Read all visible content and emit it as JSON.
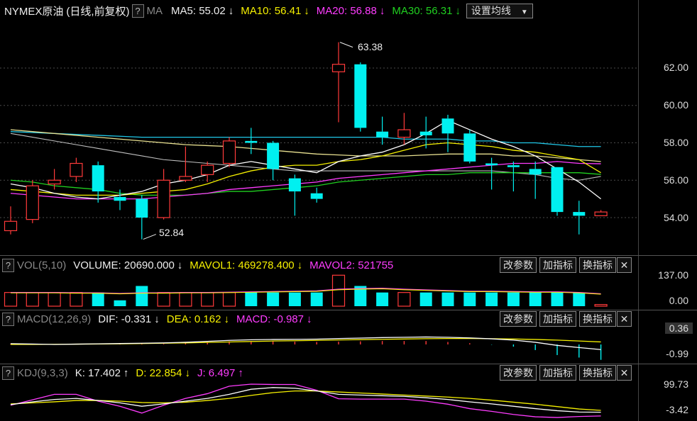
{
  "header": {
    "title": "NYMEX原油",
    "subtitle": "(日线,前复权)",
    "help": "?",
    "ma_label": "MA",
    "ma5": {
      "label": "MA5: 55.02",
      "arrow": "↓",
      "color": "#ffffff"
    },
    "ma10": {
      "label": "MA10: 56.41",
      "arrow": "↓",
      "color": "#f5f000"
    },
    "ma20": {
      "label": "MA20: 56.88",
      "arrow": "↓",
      "color": "#ff3cff"
    },
    "ma30": {
      "label": "MA30: 56.31",
      "arrow": "↓",
      "color": "#20d020"
    },
    "settings": "设置均线"
  },
  "price_axis": [
    "62.00",
    "60.00",
    "58.00",
    "56.00",
    "54.00"
  ],
  "annotations": {
    "high": "63.38",
    "low": "52.84"
  },
  "vol_panel": {
    "help": "?",
    "name": "VOL(5,10)",
    "volume": "VOLUME: 20690.000",
    "volume_arrow": "↓",
    "mavol1": "MAVOL1: 469278.400",
    "mavol1_arrow": "↓",
    "mavol2": "MAVOL2: 521755",
    "axis": [
      "137.00",
      "0.00"
    ]
  },
  "macd_panel": {
    "help": "?",
    "name": "MACD(12,26,9)",
    "dif": "DIF: -0.331",
    "dif_arrow": "↓",
    "dea": "DEA: 0.162",
    "dea_arrow": "↓",
    "macd": "MACD: -0.987",
    "macd_arrow": "↓",
    "axis": [
      "0.36",
      "-0.99"
    ]
  },
  "kdj_panel": {
    "help": "?",
    "name": "KDJ(9,3,3)",
    "k": "K: 17.402",
    "k_arrow": "↑",
    "d": "D: 22.854",
    "d_arrow": "↓",
    "j": "J: 6.497",
    "j_arrow": "↑",
    "axis": [
      "99.73",
      "-3.42"
    ]
  },
  "buttons": {
    "params": "改参数",
    "add": "加指标",
    "swap": "换指标",
    "close": "✕"
  },
  "colors": {
    "up": "#ff3a3a",
    "down": "#00f0f0",
    "ma5": "#ffffff",
    "ma10": "#f5f000",
    "ma20": "#ff3cff",
    "ma30": "#20d020"
  },
  "chart_data": {
    "type": "candlestick",
    "yaxis_ticks": [
      54,
      56,
      58,
      60,
      62
    ],
    "candles": [
      {
        "o": 53.3,
        "c": 53.8,
        "h": 54.6,
        "l": 53.1,
        "up": true
      },
      {
        "o": 53.9,
        "c": 55.7,
        "h": 56.0,
        "l": 53.7,
        "up": true
      },
      {
        "o": 55.8,
        "c": 56.0,
        "h": 56.6,
        "l": 55.5,
        "up": true
      },
      {
        "o": 56.2,
        "c": 56.9,
        "h": 57.2,
        "l": 55.9,
        "up": true
      },
      {
        "o": 56.8,
        "c": 55.4,
        "h": 57.0,
        "l": 54.8,
        "up": false
      },
      {
        "o": 55.1,
        "c": 54.9,
        "h": 55.5,
        "l": 54.4,
        "up": false
      },
      {
        "o": 55.0,
        "c": 54.0,
        "h": 55.2,
        "l": 52.84,
        "up": false
      },
      {
        "o": 54.0,
        "c": 56.0,
        "h": 56.6,
        "l": 53.9,
        "up": true
      },
      {
        "o": 56.0,
        "c": 56.2,
        "h": 57.8,
        "l": 55.9,
        "up": true
      },
      {
        "o": 56.3,
        "c": 56.8,
        "h": 57.0,
        "l": 55.9,
        "up": true
      },
      {
        "o": 56.9,
        "c": 58.1,
        "h": 58.3,
        "l": 56.7,
        "up": true
      },
      {
        "o": 58.1,
        "c": 58.0,
        "h": 58.8,
        "l": 57.4,
        "up": false
      },
      {
        "o": 58.0,
        "c": 56.6,
        "h": 58.1,
        "l": 56.0,
        "up": false
      },
      {
        "o": 56.1,
        "c": 55.4,
        "h": 56.3,
        "l": 54.1,
        "up": false
      },
      {
        "o": 55.3,
        "c": 55.0,
        "h": 55.6,
        "l": 54.8,
        "up": false
      },
      {
        "o": 61.8,
        "c": 62.2,
        "h": 63.38,
        "l": 59.1,
        "up": true
      },
      {
        "o": 62.2,
        "c": 58.8,
        "h": 62.3,
        "l": 58.6,
        "up": false
      },
      {
        "o": 58.6,
        "c": 58.3,
        "h": 59.4,
        "l": 57.9,
        "up": false
      },
      {
        "o": 58.3,
        "c": 58.7,
        "h": 59.6,
        "l": 57.9,
        "up": true
      },
      {
        "o": 58.6,
        "c": 58.4,
        "h": 59.4,
        "l": 57.7,
        "up": false
      },
      {
        "o": 59.3,
        "c": 58.5,
        "h": 59.5,
        "l": 57.5,
        "up": false
      },
      {
        "o": 58.5,
        "c": 57.0,
        "h": 58.7,
        "l": 56.9,
        "up": false
      },
      {
        "o": 56.9,
        "c": 56.8,
        "h": 57.2,
        "l": 55.5,
        "up": false
      },
      {
        "o": 56.8,
        "c": 56.7,
        "h": 57.0,
        "l": 55.4,
        "up": false
      },
      {
        "o": 56.6,
        "c": 56.3,
        "h": 57.0,
        "l": 55.0,
        "up": false
      },
      {
        "o": 56.7,
        "c": 54.3,
        "h": 56.7,
        "l": 54.1,
        "up": false
      },
      {
        "o": 54.3,
        "c": 54.1,
        "h": 54.9,
        "l": 53.1,
        "up": false
      },
      {
        "o": 54.1,
        "c": 54.3,
        "h": 54.4,
        "l": 54.1,
        "up": true
      }
    ],
    "ma5": [
      55.8,
      55.6,
      55.3,
      55.1,
      55.0,
      55.2,
      55.4,
      55.8,
      56.0,
      56.3,
      56.8,
      57.0,
      56.8,
      56.6,
      56.4,
      57.0,
      57.3,
      57.5,
      57.9,
      58.5,
      59.2,
      58.7,
      58.2,
      57.8,
      57.3,
      56.6,
      55.9,
      55.0
    ],
    "ma10": [
      55.5,
      55.4,
      55.3,
      55.2,
      55.2,
      55.2,
      55.3,
      55.4,
      55.5,
      55.8,
      56.2,
      56.5,
      56.7,
      56.8,
      56.8,
      57.0,
      57.1,
      57.3,
      57.6,
      57.9,
      58.0,
      57.9,
      57.8,
      57.6,
      57.5,
      57.3,
      57.1,
      56.4
    ],
    "ma20": [
      55.3,
      55.2,
      55.1,
      55.0,
      55.0,
      55.0,
      55.0,
      55.1,
      55.2,
      55.3,
      55.5,
      55.6,
      55.7,
      55.8,
      55.9,
      56.1,
      56.2,
      56.3,
      56.4,
      56.5,
      56.6,
      56.7,
      56.8,
      56.9,
      56.9,
      57.0,
      56.9,
      56.88
    ],
    "ma30": [
      56.0,
      55.9,
      55.7,
      55.6,
      55.5,
      55.3,
      55.2,
      55.2,
      55.2,
      55.3,
      55.4,
      55.4,
      55.5,
      55.6,
      55.7,
      55.9,
      56.0,
      56.1,
      56.2,
      56.3,
      56.3,
      56.4,
      56.4,
      56.4,
      56.4,
      56.4,
      56.4,
      56.31
    ],
    "long_line1": [
      58.6,
      58.55,
      58.5,
      58.45,
      58.4,
      58.35,
      58.3,
      58.3,
      58.3,
      58.3,
      58.3,
      58.3,
      58.3,
      58.3,
      58.3,
      58.3,
      58.3,
      58.3,
      58.2,
      58.2,
      58.2,
      58.1,
      58.1,
      58.0,
      58.0,
      57.9,
      57.8,
      57.8
    ],
    "long_line2": [
      58.7,
      58.6,
      58.5,
      58.4,
      58.3,
      58.2,
      58.1,
      58.0,
      57.9,
      57.85,
      57.8,
      57.7,
      57.6,
      57.5,
      57.4,
      57.35,
      57.3,
      57.3,
      57.3,
      57.35,
      57.4,
      57.4,
      57.4,
      57.3,
      57.3,
      57.2,
      57.1,
      57.0
    ],
    "long_line3": [
      58.5,
      58.3,
      58.1,
      57.9,
      57.7,
      57.5,
      57.3,
      57.1,
      57.0,
      56.9,
      56.8,
      56.7,
      56.6,
      56.5,
      56.5,
      56.5,
      56.5,
      56.5,
      56.5,
      56.5,
      56.5,
      56.5,
      56.5,
      56.4,
      56.3,
      56.1,
      56.0,
      56.2
    ],
    "volume": [
      0.42,
      0.42,
      0.42,
      0.42,
      0.42,
      0.18,
      0.62,
      0.42,
      0.42,
      0.42,
      0.42,
      0.42,
      0.42,
      0.42,
      0.42,
      0.95,
      0.62,
      0.42,
      0.42,
      0.42,
      0.42,
      0.42,
      0.42,
      0.42,
      0.42,
      0.42,
      0.42,
      0.05
    ],
    "mavol": [
      0.42,
      0.42,
      0.42,
      0.41,
      0.41,
      0.39,
      0.41,
      0.41,
      0.42,
      0.42,
      0.43,
      0.44,
      0.45,
      0.46,
      0.47,
      0.52,
      0.54,
      0.55,
      0.52,
      0.5,
      0.48,
      0.46,
      0.46,
      0.45,
      0.44,
      0.44,
      0.42,
      0.38
    ],
    "macd_dif": [
      0.05,
      0.03,
      0.0,
      0.02,
      0.04,
      0.06,
      0.08,
      0.1,
      0.14,
      0.2,
      0.26,
      0.3,
      0.32,
      0.33,
      0.34,
      0.38,
      0.41,
      0.44,
      0.46,
      0.48,
      0.46,
      0.42,
      0.36,
      0.28,
      0.14,
      -0.06,
      -0.2,
      -0.331
    ],
    "macd_dea": [
      0.0,
      0.0,
      0.01,
      0.02,
      0.03,
      0.04,
      0.06,
      0.08,
      0.1,
      0.13,
      0.16,
      0.19,
      0.22,
      0.24,
      0.26,
      0.29,
      0.31,
      0.33,
      0.35,
      0.37,
      0.38,
      0.38,
      0.37,
      0.35,
      0.32,
      0.28,
      0.22,
      0.162
    ],
    "macd_hist": [
      0.05,
      0.03,
      -0.02,
      0.0,
      0.02,
      0.04,
      0.04,
      0.04,
      0.08,
      0.14,
      0.2,
      0.22,
      0.2,
      0.18,
      0.16,
      0.18,
      0.2,
      0.22,
      0.22,
      0.22,
      0.16,
      0.08,
      -0.02,
      -0.14,
      -0.36,
      -0.68,
      -0.84,
      -0.987
    ],
    "kdj_k": [
      40,
      48,
      55,
      58,
      52,
      45,
      35,
      42,
      50,
      58,
      70,
      85,
      90,
      88,
      80,
      70,
      68,
      66,
      64,
      60,
      55,
      48,
      42,
      35,
      28,
      22,
      18,
      17.402
    ],
    "kdj_d": [
      42,
      45,
      48,
      52,
      52,
      50,
      46,
      45,
      47,
      52,
      58,
      67,
      75,
      80,
      80,
      77,
      74,
      71,
      68,
      65,
      62,
      58,
      53,
      47,
      41,
      34,
      27,
      22.854
    ],
    "kdj_j": [
      38,
      54,
      70,
      70,
      50,
      35,
      15,
      38,
      58,
      72,
      94,
      100,
      99,
      99,
      82,
      57,
      56,
      56,
      56,
      50,
      41,
      28,
      20,
      11,
      4,
      2,
      5,
      6.497
    ]
  }
}
